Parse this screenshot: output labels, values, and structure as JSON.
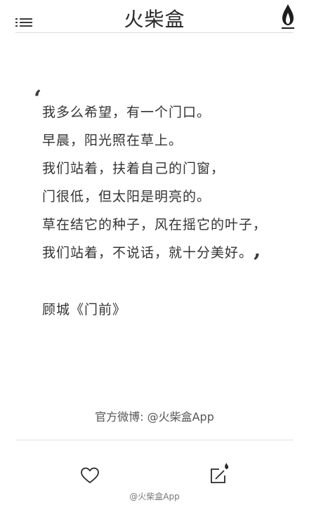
{
  "header": {
    "app_title": "火柴盒",
    "menu_icon": "list-menu-icon",
    "logo_icon": "match-flame-logo"
  },
  "poem": {
    "lines": [
      "我多么希望，有一个门口。",
      "早晨，阳光照在草上。",
      "我们站着，扶着自己的门窗，",
      "门很低，但太阳是明亮的。",
      "草在结它的种子，风在摇它的叶子，",
      "我们站着，不说话，就十分美好。"
    ],
    "open_quote": "‘",
    "close_quote": "’",
    "attribution": "顾城《门前》"
  },
  "footer": {
    "weibo": "官方微博: @火柴盒App",
    "like_icon": "heart-icon",
    "share_icon": "share-icon",
    "watermark": "@火柴盒App"
  }
}
